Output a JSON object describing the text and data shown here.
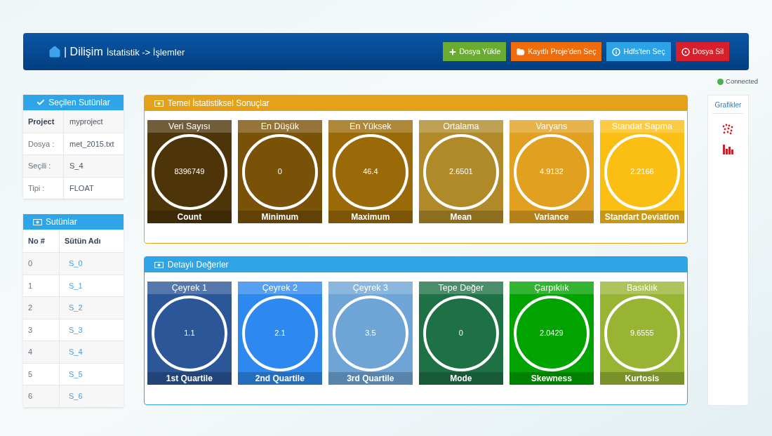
{
  "navbar": {
    "brand": "| Dilişim",
    "breadcrumb": "İstatistik -> İşlemler",
    "buttons": [
      {
        "label": "Dosya Yükle",
        "kind": "upload",
        "color": "#6aac2f"
      },
      {
        "label": "Kayıtlı Proje'den Seç",
        "kind": "folder",
        "color": "#ef6c0c"
      },
      {
        "label": "Hdfs'ten Seç",
        "kind": "info",
        "color": "#2ba3e6"
      },
      {
        "label": "Dosya Sil",
        "kind": "remove",
        "color": "#d91f2b"
      }
    ]
  },
  "connection": {
    "label": "Connected",
    "color": "#4caf50"
  },
  "selected_columns": {
    "title": "Seçilen Sutünlar",
    "rows": [
      {
        "key": "Project",
        "value": "myproject",
        "bold": true
      },
      {
        "key": "Dosya :",
        "value": "met_2015.txt",
        "bold": false
      },
      {
        "key": "Seçili :",
        "value": "S_4",
        "bold": false
      },
      {
        "key": "Tipi :",
        "value": "FLOAT",
        "bold": false
      }
    ]
  },
  "columns": {
    "title": "Sutünlar",
    "headers": [
      "No #",
      "Sütün Adı"
    ],
    "rows": [
      {
        "no": "0",
        "name": "S_0"
      },
      {
        "no": "1",
        "name": "S_1"
      },
      {
        "no": "2",
        "name": "S_2"
      },
      {
        "no": "3",
        "name": "S_3"
      },
      {
        "no": "4",
        "name": "S_4"
      },
      {
        "no": "5",
        "name": "S_5"
      },
      {
        "no": "6",
        "name": "S_6"
      }
    ]
  },
  "panels": [
    {
      "title": "Temel İstatistiksel Sonuçlar",
      "color": "#e3a21a",
      "tiles": [
        {
          "top": "Veri Sayısı",
          "value": "8396749",
          "bottom": "Count",
          "color": "#4e3509"
        },
        {
          "top": "En Düşük",
          "value": "0",
          "bottom": "Minimum",
          "color": "#7a5207"
        },
        {
          "top": "En Yüksek",
          "value": "46.4",
          "bottom": "Maximum",
          "color": "#9a6a08"
        },
        {
          "top": "Ortalama",
          "value": "2.6501",
          "bottom": "Mean",
          "color": "#b08a28"
        },
        {
          "top": "Varyans",
          "value": "4.9132",
          "bottom": "Variance",
          "color": "#e2a020"
        },
        {
          "top": "Standat Sapma",
          "value": "2.2166",
          "bottom": "Standart Deviation",
          "color": "#fbbf14"
        }
      ]
    },
    {
      "title": "Detaylı Değerler",
      "color": "#2fa4e7",
      "tiles": [
        {
          "top": "Çeyrek 1",
          "value": "1.1",
          "bottom": "1st Quartile",
          "color": "#2b5697"
        },
        {
          "top": "Çeyrek 2",
          "value": "2.1",
          "bottom": "2nd Quartile",
          "color": "#2d89ef"
        },
        {
          "top": "Çeyrek 3",
          "value": "3.5",
          "bottom": "3rd Quartile",
          "color": "#6fa5d6"
        },
        {
          "top": "Tepe Değer",
          "value": "0",
          "bottom": "Mode",
          "color": "#1e7145"
        },
        {
          "top": "Çarpıklık",
          "value": "2.0429",
          "bottom": "Skewness",
          "color": "#00a300"
        },
        {
          "top": "Basıklık",
          "value": "9.6555",
          "bottom": "Kurtosis",
          "color": "#99b433"
        }
      ]
    }
  ],
  "charts_panel": {
    "title": "Grafikler"
  }
}
